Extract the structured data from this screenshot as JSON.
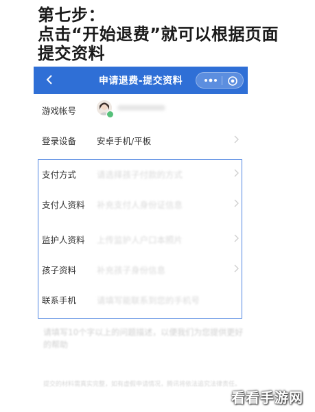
{
  "caption": {
    "line1": "第七步：",
    "line2": "点击“开始退费”就可以根据页面",
    "line3": "提交资料"
  },
  "topbar": {
    "back_icon": "chevron-left-icon",
    "title": "申请退费-提交资料",
    "more_icon": "more-dots-icon",
    "close_icon": "target-icon",
    "color": "#2f6fd6"
  },
  "account": {
    "label": "游戏帐号"
  },
  "device": {
    "label": "登录设备",
    "value": "安卓手机/平板"
  },
  "form": {
    "rows": [
      {
        "label": "支付方式",
        "placeholder": "请选择孩子付款的方式"
      },
      {
        "label": "支付人资料",
        "placeholder": "补充支付人身份证信息"
      },
      {
        "label": "监护人资料",
        "placeholder": "上传监护人户口本照片"
      },
      {
        "label": "孩子资料",
        "placeholder": "补充孩子身份信息"
      },
      {
        "label": "联系手机",
        "placeholder": "请填写能联系到您的手机号"
      }
    ]
  },
  "note": "请填写10个字以上的问题描述，以便我们为您提供更好的帮助",
  "legal": "提交的材料需真实完整，如有虚假申请情况，腾讯将依法追究法律责任。",
  "watermark": "看看手游网"
}
